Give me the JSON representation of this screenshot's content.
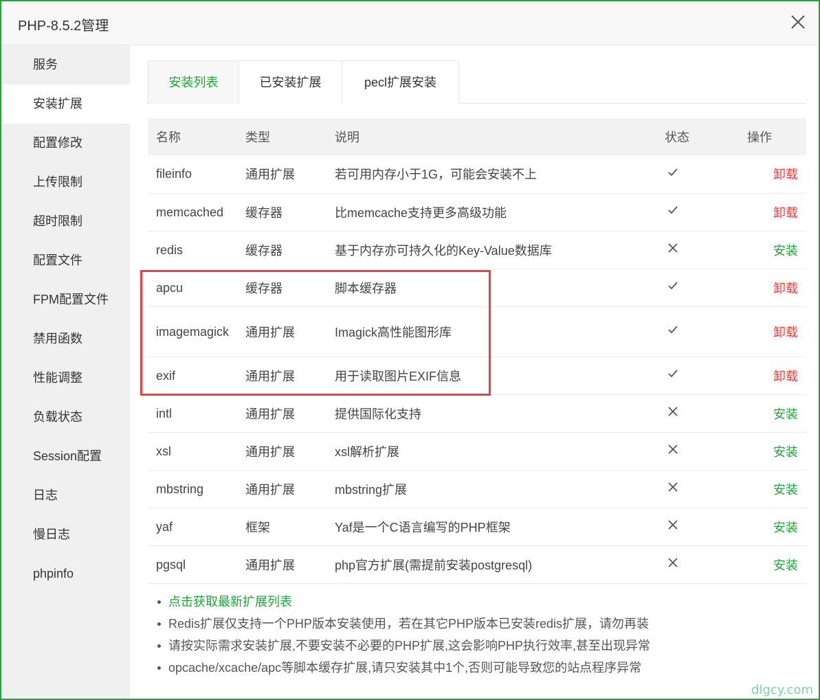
{
  "window": {
    "title": "PHP-8.5.2管理"
  },
  "sidebar": {
    "items": [
      {
        "label": "服务"
      },
      {
        "label": "安装扩展"
      },
      {
        "label": "配置修改"
      },
      {
        "label": "上传限制"
      },
      {
        "label": "超时限制"
      },
      {
        "label": "配置文件"
      },
      {
        "label": "FPM配置文件"
      },
      {
        "label": "禁用函数"
      },
      {
        "label": "性能调整"
      },
      {
        "label": "负载状态"
      },
      {
        "label": "Session配置"
      },
      {
        "label": "日志"
      },
      {
        "label": "慢日志"
      },
      {
        "label": "phpinfo"
      }
    ],
    "active_index": 1
  },
  "tabs": [
    {
      "label": "安装列表"
    },
    {
      "label": "已安装扩展"
    },
    {
      "label": "pecl扩展安装"
    }
  ],
  "table": {
    "headers": {
      "name": "名称",
      "type": "类型",
      "desc": "说明",
      "status": "状态",
      "op": "操作"
    },
    "rows": [
      {
        "name": "fileinfo",
        "type": "通用扩展",
        "desc": "若可用内存小于1G，可能会安装不上",
        "status": "installed",
        "op": "卸载"
      },
      {
        "name": "memcached",
        "type": "缓存器",
        "desc": "比memcache支持更多高级功能",
        "status": "installed",
        "op": "卸载"
      },
      {
        "name": "redis",
        "type": "缓存器",
        "desc": "基于内存亦可持久化的Key-Value数据库",
        "status": "not_installed",
        "op": "安装"
      },
      {
        "name": "apcu",
        "type": "缓存器",
        "desc": "脚本缓存器",
        "status": "installed",
        "op": "卸载"
      },
      {
        "name": "imagemagick",
        "type": "通用扩展",
        "desc": "Imagick高性能图形库",
        "status": "installed",
        "op": "卸载"
      },
      {
        "name": "exif",
        "type": "通用扩展",
        "desc": "用于读取图片EXIF信息",
        "status": "installed",
        "op": "卸载"
      },
      {
        "name": "intl",
        "type": "通用扩展",
        "desc": "提供国际化支持",
        "status": "not_installed",
        "op": "安装"
      },
      {
        "name": "xsl",
        "type": "通用扩展",
        "desc": "xsl解析扩展",
        "status": "not_installed",
        "op": "安装"
      },
      {
        "name": "mbstring",
        "type": "通用扩展",
        "desc": "mbstring扩展",
        "status": "not_installed",
        "op": "安装"
      },
      {
        "name": "yaf",
        "type": "框架",
        "desc": "Yaf是一个C语言编写的PHP框架",
        "status": "not_installed",
        "op": "安装"
      },
      {
        "name": "pgsql",
        "type": "通用扩展",
        "desc": "php官方扩展(需提前安装postgresql)",
        "status": "not_installed",
        "op": "安装"
      }
    ]
  },
  "notes": {
    "link": "点击获取最新扩展列表",
    "items": [
      "Redis扩展仅支持一个PHP版本安装使用，若在其它PHP版本已安装redis扩展，请勿再装",
      "请按实际需求安装扩展,不要安装不必要的PHP扩展,这会影响PHP执行效率,甚至出现异常",
      "opcache/xcache/apc等脚本缓存扩展,请只安装其中1个,否则可能导致您的站点程序异常"
    ]
  },
  "watermark": "dlgcy.com",
  "colors": {
    "accent": "#20a53a",
    "danger": "#ff3b3b",
    "highlight": "#f03e3e"
  }
}
